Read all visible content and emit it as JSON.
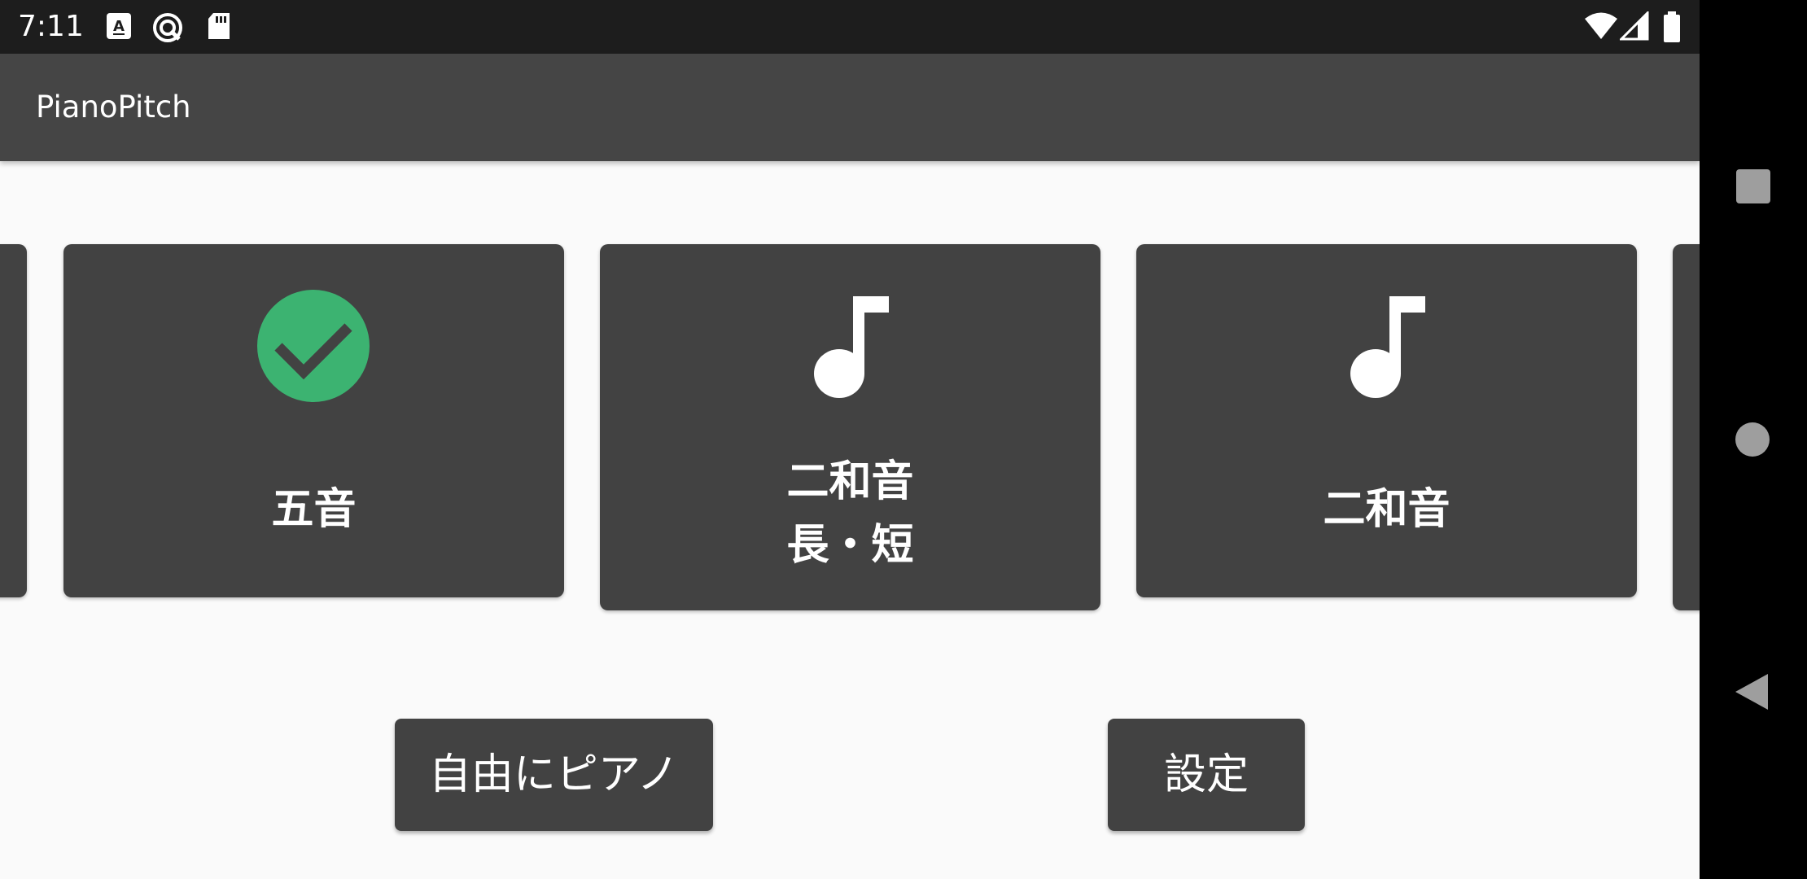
{
  "status_bar": {
    "time": "7:11",
    "icons": [
      "keyboard-a-icon",
      "sync-badge-icon",
      "sd-card-icon",
      "wifi-icon",
      "cell-signal-icon",
      "battery-icon"
    ]
  },
  "app_bar": {
    "title": "PianoPitch"
  },
  "cards": [
    {
      "label": "",
      "icon": "none"
    },
    {
      "label": "五音",
      "icon": "check-circle-icon",
      "icon_color": "#3cb371"
    },
    {
      "label_line1": "二和音",
      "label_line2": "長・短",
      "icon": "music-note-icon"
    },
    {
      "label": "二和音",
      "icon": "music-note-icon"
    },
    {
      "label": "",
      "icon": "none"
    }
  ],
  "buttons": {
    "free_piano": "自由にピアノ",
    "settings": "設定"
  },
  "nav_bar": {
    "icons": [
      "recents-square-icon",
      "home-circle-icon",
      "back-triangle-icon"
    ]
  },
  "colors": {
    "status_bar": "#1d1d1d",
    "app_bar": "#454545",
    "card": "#424242",
    "background": "#fafafa",
    "check": "#3cb371"
  }
}
